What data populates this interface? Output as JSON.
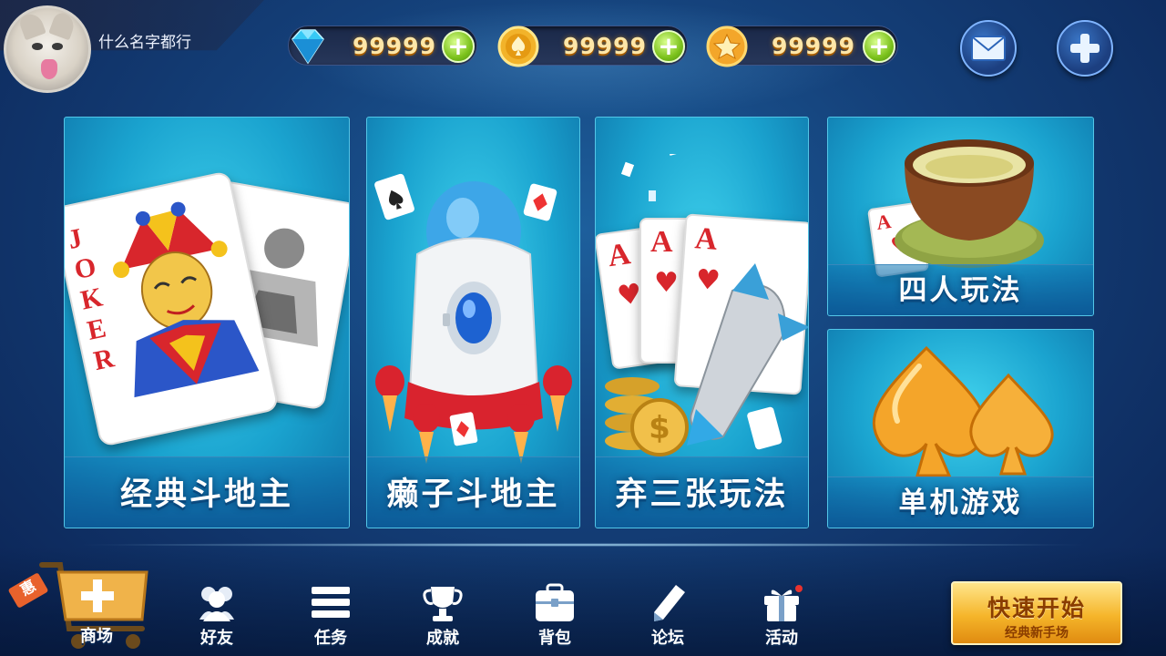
{
  "user": {
    "name": "什么名字都行"
  },
  "currencies": [
    {
      "icon": "diamond-icon",
      "value": "99999",
      "add": "+"
    },
    {
      "icon": "gold-coin-icon",
      "value": "99999",
      "add": "+"
    },
    {
      "icon": "star-coin-icon",
      "value": "99999",
      "add": "+"
    }
  ],
  "header_buttons": {
    "mail": "mail-icon",
    "add": "plus-icon"
  },
  "modes": [
    {
      "label": "经典斗地主",
      "art": "joker-cards"
    },
    {
      "label": "癞子斗地主",
      "art": "rocket"
    },
    {
      "label": "弃三张玩法",
      "art": "three-aces-missile"
    },
    {
      "label": "四人玩法",
      "art": "tea-cup"
    },
    {
      "label": "单机游戏",
      "art": "golden-spades"
    }
  ],
  "joker_letters": "JOKER",
  "ace_letter": "A",
  "nav": {
    "shop": {
      "label": "商场",
      "tag": "惠"
    },
    "items": [
      {
        "label": "好友",
        "icon": "friends-icon"
      },
      {
        "label": "任务",
        "icon": "task-list-icon"
      },
      {
        "label": "成就",
        "icon": "trophy-icon"
      },
      {
        "label": "背包",
        "icon": "backpack-icon"
      },
      {
        "label": "论坛",
        "icon": "pencil-icon"
      },
      {
        "label": "活动",
        "icon": "gift-icon"
      }
    ]
  },
  "quick_start": {
    "title": "快速开始",
    "subtitle": "经典新手场"
  },
  "colors": {
    "card_cyan": "#1aa3cf",
    "gold": "#f5b52a",
    "accent_green": "#7cc21c"
  }
}
